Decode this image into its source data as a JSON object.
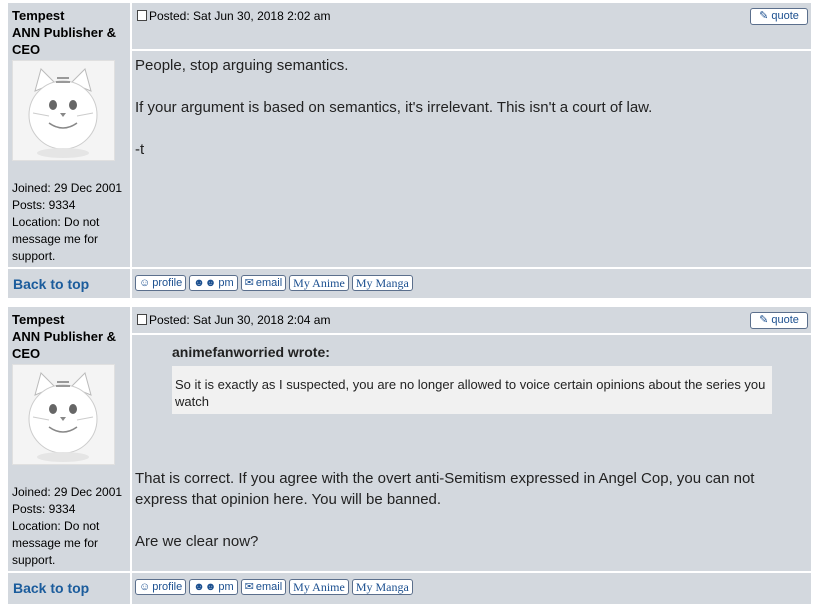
{
  "posts": [
    {
      "author": "Tempest",
      "rank": "ANN Publisher & CEO",
      "joined": "Joined: 29 Dec 2001",
      "posts": "Posts: 9334",
      "location": "Location: Do not message me for support.",
      "posted": "Posted: Sat Jun 30, 2018 2:02 am",
      "body": [
        "People, stop arguing semantics.",
        "If your argument is based on semantics, it's irrelevant. This isn't a court of law.",
        "-t"
      ]
    },
    {
      "author": "Tempest",
      "rank": "ANN Publisher & CEO",
      "joined": "Joined: 29 Dec 2001",
      "posts": "Posts: 9334",
      "location": "Location: Do not message me for support.",
      "posted": "Posted: Sat Jun 30, 2018 2:04 am",
      "quote": {
        "author": "animefanworried wrote:",
        "text": "So it is exactly as I suspected, you are no longer allowed to voice certain opinions about the series you watch"
      },
      "body": [
        "That is correct. If you agree with the overt anti-Semitism expressed in Angel Cop, you can not express that opinion here. You will be banned.",
        "Are we clear now?"
      ]
    }
  ],
  "labels": {
    "quote": "quote",
    "back_to_top": "Back to top",
    "profile": "profile",
    "pm": "pm",
    "email": "email",
    "my_anime": "My Anime",
    "my_manga": "My Manga"
  },
  "colors": {
    "panel": "#d3d8de",
    "link": "#1b5c9c"
  }
}
